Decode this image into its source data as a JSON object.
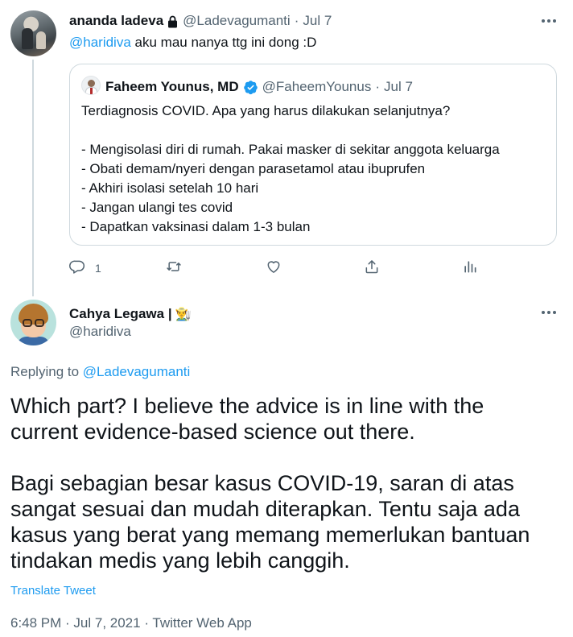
{
  "parent_tweet": {
    "author_name": "ananda ladeva",
    "author_handle": "@Ladevagumanti",
    "separator": "·",
    "date": "Jul 7",
    "mention": "@haridiva",
    "text": " aku mau nanya ttg ini dong :D",
    "quote": {
      "author_name": "Faheem Younus, MD",
      "author_handle": "@FaheemYounus",
      "separator": "·",
      "date": "Jul 7",
      "lines": [
        "Terdiagnosis COVID. Apa yang harus dilakukan selanjutnya?",
        "",
        "- Mengisolasi diri di rumah. Pakai masker di sekitar anggota keluarga",
        "- Obati demam/nyeri dengan parasetamol atau ibuprufen",
        "- Akhiri isolasi setelah 10 hari",
        "- Jangan ulangi tes covid",
        "- Dapatkan vaksinasi dalam 1-3 bulan"
      ]
    },
    "actions": {
      "reply_count": "1"
    }
  },
  "main_tweet": {
    "author_name": "Cahya Legawa |",
    "author_emoji": "👨‍🌾",
    "author_handle": "@haridiva",
    "replying_prefix": "Replying to ",
    "replying_to": "@Ladevagumanti",
    "body_lines": [
      "Which part? I believe the advice is in line with the",
      "current evidence-based science out there.",
      "",
      "Bagi sebagian besar kasus COVID-19, saran di atas",
      "sangat sesuai dan mudah diterapkan. Tentu saja ada",
      "kasus yang berat yang memang memerlukan bantuan",
      "tindakan medis yang lebih canggih."
    ],
    "translate_label": "Translate Tweet",
    "meta": "6:48 PM · Jul 7, 2021 · Twitter Web App"
  },
  "colors": {
    "accent": "#1d9bf0",
    "secondary_text": "#536471",
    "border": "#cfd9de"
  },
  "icons": [
    "lock-icon",
    "verified-icon",
    "more-icon",
    "reply-icon",
    "retweet-icon",
    "like-icon",
    "share-icon",
    "analytics-icon"
  ]
}
